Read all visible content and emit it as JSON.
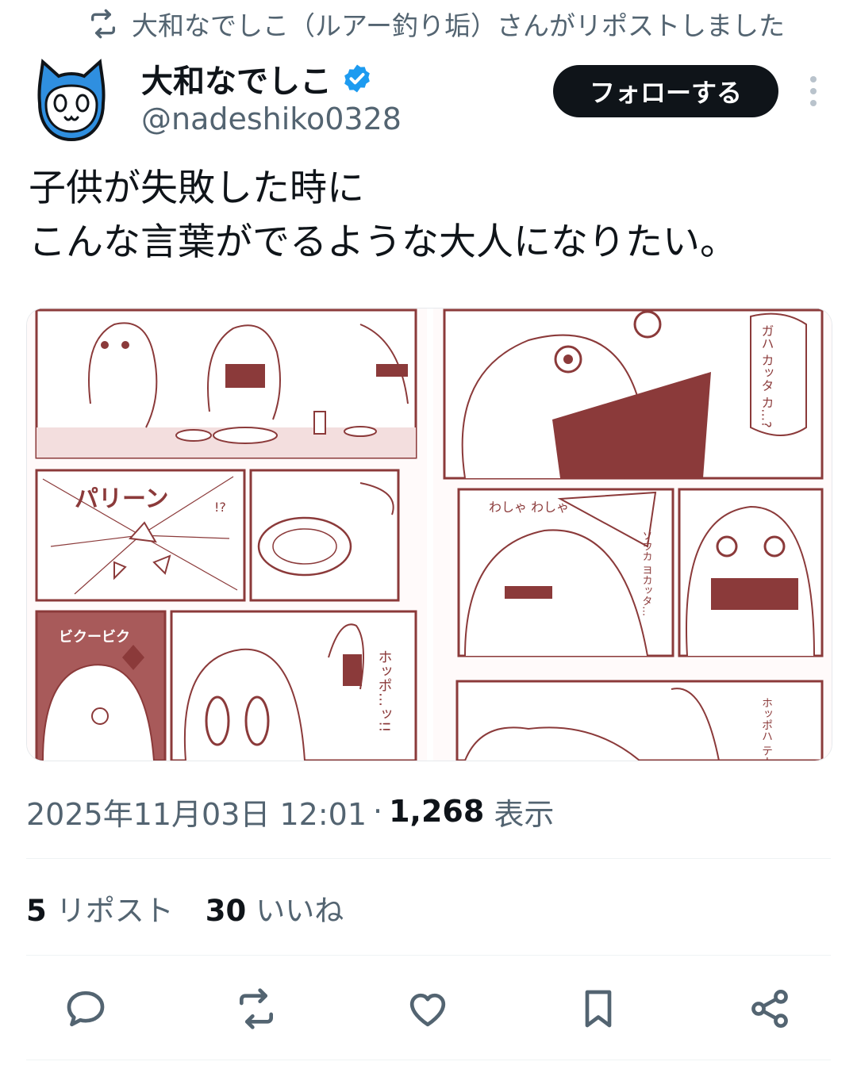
{
  "repost_banner": {
    "icon": "repost-icon",
    "text": "大和なでしこ（ルアー釣り垢）さんがリポストしました"
  },
  "author": {
    "display_name": "大和なでしこ",
    "handle": "@nadeshiko0328",
    "verified": true,
    "avatar_icon": "cat-face-avatar"
  },
  "follow_button": {
    "label": "フォローする"
  },
  "more_menu": {
    "icon": "more-vertical-icon"
  },
  "tweet": {
    "lines": [
      "子供が失敗した時に",
      "こんな言葉がでるような大人になりたい。"
    ]
  },
  "media": {
    "images": [
      {
        "name": "manga-page-1",
        "texts": [
          "パリーン",
          "!?",
          "ビクービク",
          "ホッポ…ッ!!"
        ]
      },
      {
        "name": "manga-page-2",
        "texts": [
          "ガハ カッタ カ…?",
          "ソウカ ヨカッタ…",
          "わしゃ わしゃ",
          "ホッポハ テーブル フイテクル"
        ]
      }
    ]
  },
  "meta": {
    "timestamp": "2025年11月03日 12:01",
    "separator": "·",
    "views_count": "1,268",
    "views_label": "表示"
  },
  "stats": {
    "reposts_count": "5",
    "reposts_label": "リポスト",
    "likes_count": "30",
    "likes_label": "いいね"
  },
  "actions": [
    {
      "icon": "reply-icon"
    },
    {
      "icon": "repost-icon"
    },
    {
      "icon": "like-heart-icon"
    },
    {
      "icon": "bookmark-icon"
    },
    {
      "icon": "share-icon"
    }
  ],
  "colors": {
    "text_primary": "#0f1419",
    "text_secondary": "#536471",
    "verified_blue": "#1d9bf0",
    "manga_ink": "#8b3a3a",
    "avatar_blue": "#2f8fe0"
  }
}
